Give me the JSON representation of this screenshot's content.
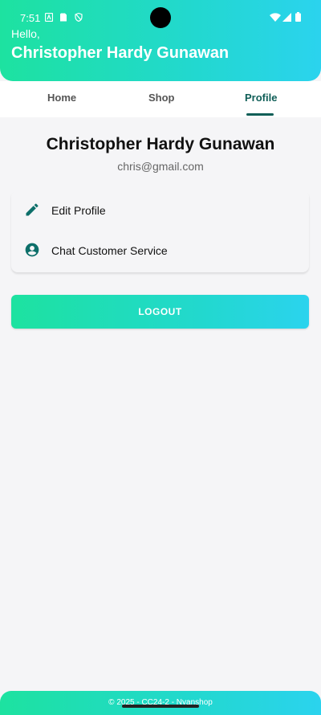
{
  "status_bar": {
    "time": "7:51"
  },
  "header": {
    "greeting": "Hello,",
    "username": "Christopher Hardy Gunawan"
  },
  "tabs": [
    {
      "label": "Home",
      "active": false
    },
    {
      "label": "Shop",
      "active": false
    },
    {
      "label": "Profile",
      "active": true
    }
  ],
  "profile": {
    "name": "Christopher Hardy Gunawan",
    "email": "chris@gmail.com"
  },
  "menu": [
    {
      "label": "Edit Profile",
      "icon": "pencil-icon"
    },
    {
      "label": "Chat Customer Service",
      "icon": "account-circle-icon"
    }
  ],
  "logout_label": "LOGOUT",
  "footer": {
    "text": "© 2025 - CC24-2 - Nyanshop"
  },
  "colors": {
    "gradient_start": "#1de2a0",
    "gradient_end": "#2bd3ee",
    "accent": "#0f5e57",
    "icon": "#0d6f6a"
  }
}
